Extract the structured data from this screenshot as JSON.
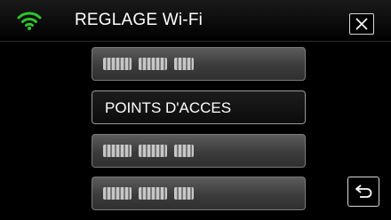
{
  "header": {
    "wifi_icon": "wifi-icon",
    "title": "REGLAGE Wi-Fi",
    "close_icon": "close-icon"
  },
  "menu": {
    "items": [
      {
        "label": "",
        "obscured": true
      },
      {
        "label": "POINTS D'ACCES",
        "obscured": false,
        "selected": true
      },
      {
        "label": "",
        "obscured": true
      },
      {
        "label": "",
        "obscured": true
      }
    ]
  },
  "footer": {
    "back_icon": "back-return-icon"
  },
  "colors": {
    "wifi_green": "#2fc42f",
    "button_gradient_top": "#5c5c5c",
    "button_gradient_bottom": "#2f2f2f",
    "selected_button": "#111111"
  }
}
